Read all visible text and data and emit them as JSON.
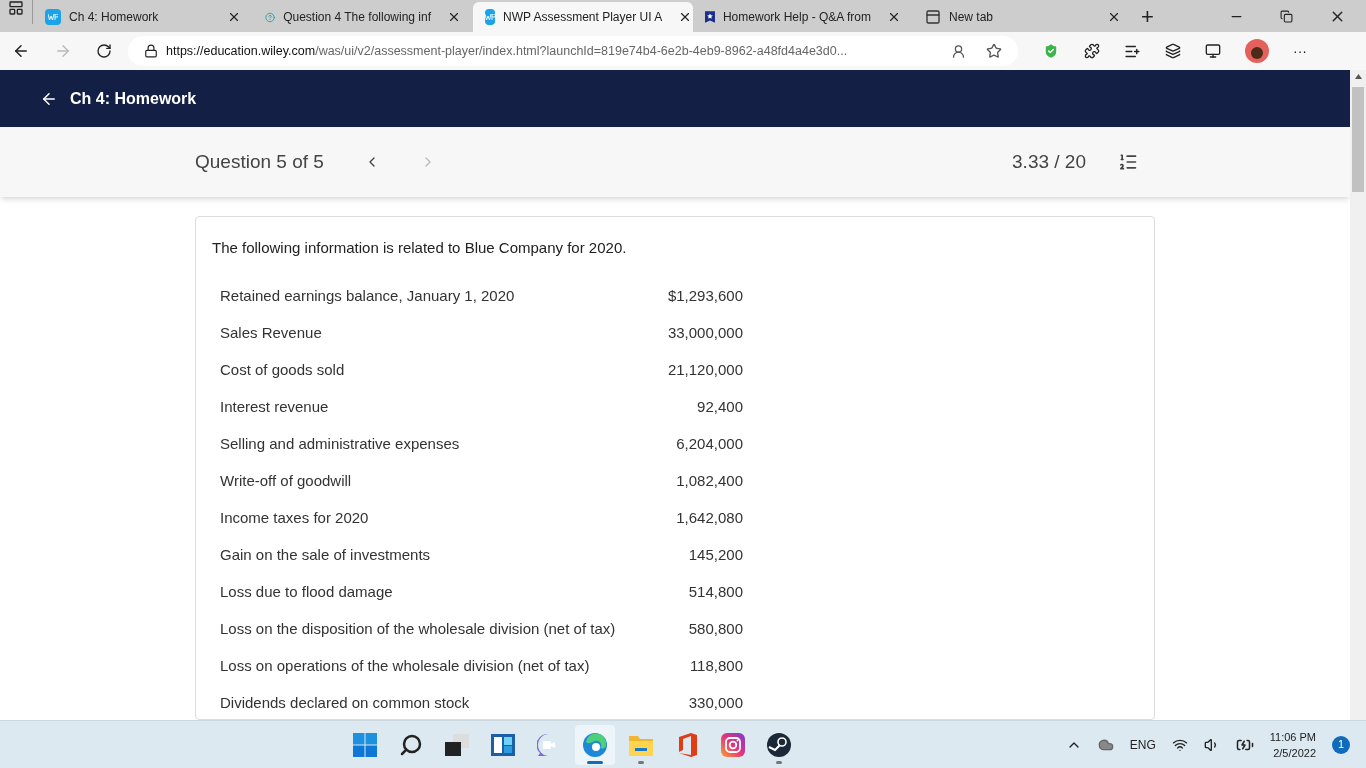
{
  "browser": {
    "tabs": [
      {
        "title": "Ch 4: Homework",
        "kind": "wp",
        "selected": false
      },
      {
        "title": "Question 4 The following inf",
        "kind": "question",
        "selected": false
      },
      {
        "title": "NWP Assessment Player UI A",
        "kind": "wp",
        "selected": true
      },
      {
        "title": "Homework Help - Q&A from",
        "kind": "shield",
        "selected": false
      },
      {
        "title": "New tab",
        "kind": "newtab",
        "selected": false
      }
    ],
    "new_tab_button": "+",
    "url": {
      "host": "https://education.wiley.com",
      "path": "/was/ui/v2/assessment-player/index.html?launchId=819e74b4-6e2b-4eb9-8962-a48fd4a4e3d0..."
    },
    "more_button": "···"
  },
  "header": {
    "title": "Ch 4: Homework"
  },
  "question_bar": {
    "position": "Question 5 of 5",
    "prev_enabled": true,
    "next_enabled": false,
    "score": "3.33 / 20"
  },
  "question": {
    "intro": "The following information is related to Blue Company for 2020.",
    "rows": [
      {
        "label": "Retained earnings balance, January 1, 2020",
        "value": "$1,293,600"
      },
      {
        "label": "Sales Revenue",
        "value": "33,000,000"
      },
      {
        "label": "Cost of goods sold",
        "value": "21,120,000"
      },
      {
        "label": "Interest revenue",
        "value": "92,400"
      },
      {
        "label": "Selling and administrative expenses",
        "value": "6,204,000"
      },
      {
        "label": "Write-off of goodwill",
        "value": "1,082,400"
      },
      {
        "label": "Income taxes for 2020",
        "value": "1,642,080"
      },
      {
        "label": "Gain on the sale of investments",
        "value": "145,200"
      },
      {
        "label": "Loss due to flood damage",
        "value": "514,800"
      },
      {
        "label": "Loss on the disposition of the wholesale division (net of tax)",
        "value": "580,800"
      },
      {
        "label": "Loss on operations of the wholesale division (net of tax)",
        "value": "118,800"
      },
      {
        "label": "Dividends declared on common stock",
        "value": "330,000"
      }
    ]
  },
  "taskbar": {
    "apps": [
      {
        "kind": "start",
        "selected": false,
        "running": false
      },
      {
        "kind": "search",
        "selected": false,
        "running": false
      },
      {
        "kind": "taskview",
        "selected": false,
        "running": false
      },
      {
        "kind": "widgets",
        "selected": false,
        "running": false
      },
      {
        "kind": "chat",
        "selected": false,
        "running": false
      },
      {
        "kind": "edge",
        "selected": true,
        "running": true
      },
      {
        "kind": "explorer",
        "selected": false,
        "running": true
      },
      {
        "kind": "office",
        "selected": false,
        "running": false
      },
      {
        "kind": "instagram",
        "selected": false,
        "running": false
      },
      {
        "kind": "steam",
        "selected": false,
        "running": true
      }
    ],
    "language": "ENG",
    "time": "11:06 PM",
    "date": "2/5/2022",
    "notifications": "1"
  }
}
